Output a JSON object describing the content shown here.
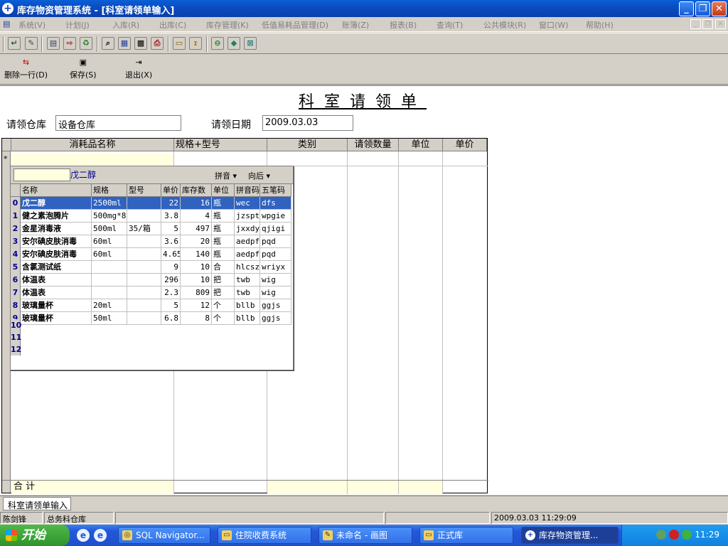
{
  "window": {
    "title": "库存物资管理系统 - [科室请领单输入]",
    "minimize": "_",
    "restore": "❐",
    "close": "✕"
  },
  "menu": {
    "items": [
      "系统(V)",
      "计划(J)",
      "入库(R)",
      "出库(C)",
      "库存管理(K)",
      "低值易耗品管理(D)",
      "账簿(Z)",
      "报表(B)",
      "查询(T)",
      "公共模块(R)",
      "窗口(W)",
      "帮助(H)"
    ],
    "mdi_min": "_",
    "mdi_restore": "❐",
    "mdi_close": "✕"
  },
  "toolbar": {
    "icons": [
      "open-icon",
      "edit-icon",
      "doc-icon",
      "export-icon",
      "recycle-icon",
      "search-icon",
      "calendar-icon",
      "grid-icon",
      "print-icon",
      "folder-icon",
      "thermometer-icon",
      "stop-icon",
      "book-icon",
      "window-icon"
    ]
  },
  "actions": {
    "delete_row": "删除一行(D)",
    "save": "保存(S)",
    "exit": "退出(X)"
  },
  "form": {
    "title": "科室请领单",
    "warehouse_label": "请领仓库",
    "warehouse_value": "设备仓库",
    "date_label": "请领日期",
    "date_value": "2009.03.03"
  },
  "grid": {
    "columns": [
      "消耗品名称",
      "规格+型号",
      "类别",
      "请领数量",
      "单位",
      "单价"
    ],
    "new_row_marker": "*",
    "sum_label": "合  计"
  },
  "lookup": {
    "search_text": "戊二醇",
    "option_mode": "拼音 ▾",
    "option_direction": "向后 ▾",
    "columns": [
      "名称",
      "规格",
      "型号",
      "单价",
      "库存数",
      "单位",
      "拼音码",
      "五笔码"
    ],
    "rows": [
      {
        "n": "0",
        "name": "戊二醇",
        "spec": "2500ml",
        "model": "",
        "price": "22",
        "stock": "16",
        "unit": "瓶",
        "py": "wec",
        "wb": "dfs"
      },
      {
        "n": "1",
        "name": "健之素泡腾片",
        "spec": "500mg*8",
        "model": "",
        "price": "3.8",
        "stock": "4",
        "unit": "瓶",
        "py": "jzspt",
        "wb": "wpgie"
      },
      {
        "n": "2",
        "name": "金星消毒液",
        "spec": "500ml",
        "model": "35/箱",
        "price": "5",
        "stock": "497",
        "unit": "瓶",
        "py": "jxxdy",
        "wb": "qjigi"
      },
      {
        "n": "3",
        "name": "安尔碘皮肤消毒",
        "spec": "60ml",
        "model": "",
        "price": "3.6",
        "stock": "20",
        "unit": "瓶",
        "py": "aedpf",
        "wb": "pqd"
      },
      {
        "n": "4",
        "name": "安尔碘皮肤消毒",
        "spec": "60ml",
        "model": "",
        "price": "4.65",
        "stock": "140",
        "unit": "瓶",
        "py": "aedpf",
        "wb": "pqd"
      },
      {
        "n": "5",
        "name": "含氯测试纸",
        "spec": "",
        "model": "",
        "price": "9",
        "stock": "10",
        "unit": "合",
        "py": "hlcsz",
        "wb": "wriyx"
      },
      {
        "n": "6",
        "name": "体温表",
        "spec": "",
        "model": "",
        "price": "296",
        "stock": "10",
        "unit": "把",
        "py": "twb",
        "wb": "wig"
      },
      {
        "n": "7",
        "name": "体温表",
        "spec": "",
        "model": "",
        "price": "2.3",
        "stock": "809",
        "unit": "把",
        "py": "twb",
        "wb": "wig"
      },
      {
        "n": "8",
        "name": "玻璃量杯",
        "spec": "20ml",
        "model": "",
        "price": "5",
        "stock": "12",
        "unit": "个",
        "py": "bllb",
        "wb": "ggjs"
      },
      {
        "n": "9",
        "name": "玻璃量杯",
        "spec": "50ml",
        "model": "",
        "price": "6.8",
        "stock": "8",
        "unit": "个",
        "py": "bllb",
        "wb": "ggjs"
      }
    ],
    "empty_rows": [
      "10",
      "11",
      "12"
    ]
  },
  "tabs": {
    "active": "科室请领单输入"
  },
  "status": {
    "user": "陈剑锋",
    "warehouse": "总务科仓库",
    "datetime": "2009.03.03 11:29:09"
  },
  "taskbar": {
    "start": "开始",
    "tasks": [
      "SQL Navigator...",
      "住院收费系统",
      "未命名 - 画图",
      "正式库",
      "库存物资管理..."
    ],
    "clock": "11:29"
  }
}
